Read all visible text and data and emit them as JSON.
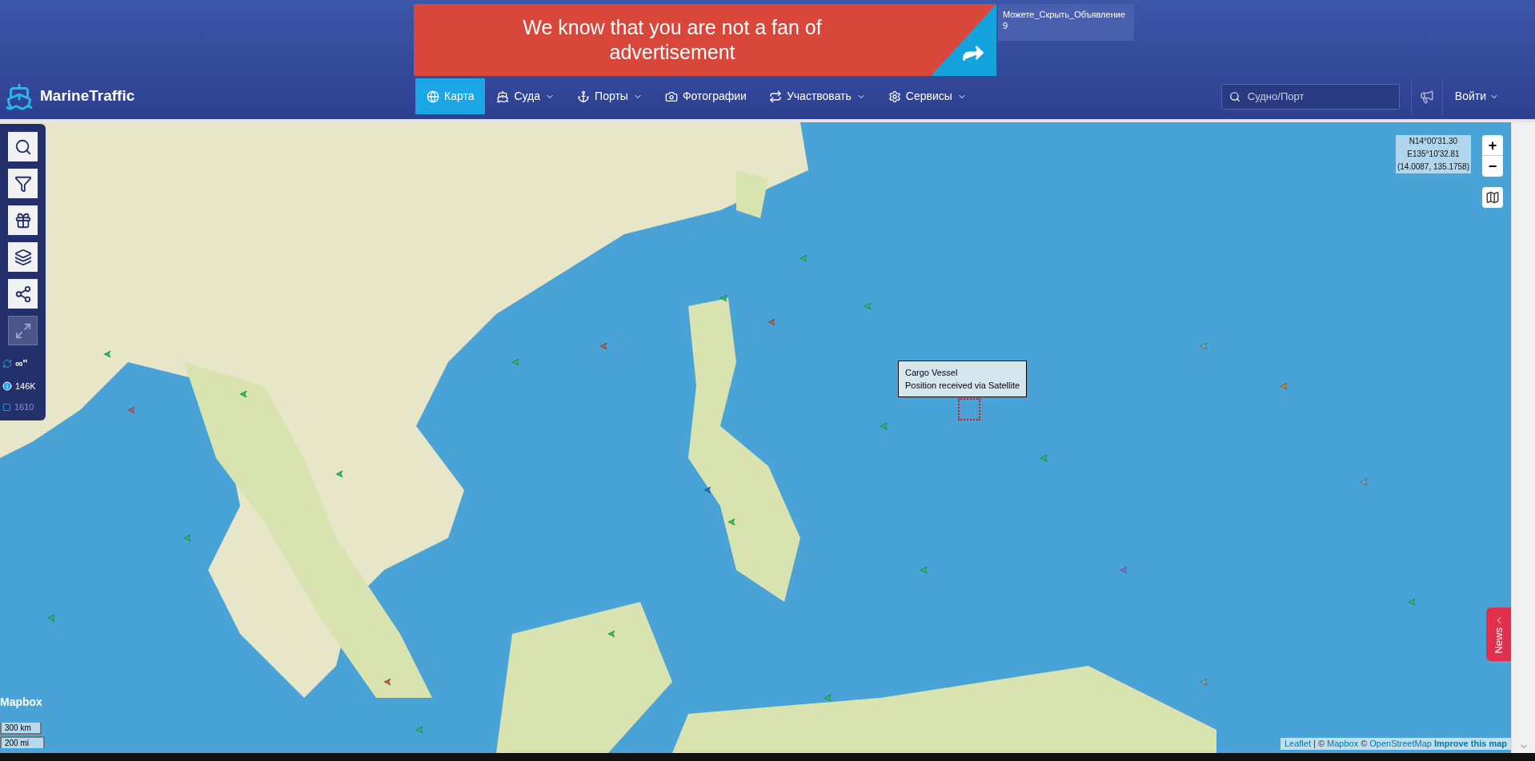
{
  "header": {
    "logo": {
      "text": "MarineTraffic"
    },
    "ad": {
      "text": "We know that you are not a fan of advertisement",
      "hide_label": "Можете_Скрыть_Объявление",
      "countdown": "9"
    },
    "nav": [
      {
        "label": "Карта",
        "dropdown": false,
        "selected": true
      },
      {
        "label": "Суда",
        "dropdown": true,
        "selected": false
      },
      {
        "label": "Порты",
        "dropdown": true,
        "selected": false
      },
      {
        "label": "Фотографии",
        "dropdown": false,
        "selected": false
      },
      {
        "label": "Участвовать",
        "dropdown": true,
        "selected": false
      },
      {
        "label": "Сервисы",
        "dropdown": true,
        "selected": false
      }
    ],
    "search": {
      "placeholder": "Судно/Порт"
    },
    "login": {
      "label": "Войти"
    }
  },
  "map": {
    "toolbar": {
      "buttons": [
        {
          "disabled": false
        },
        {
          "disabled": false
        },
        {
          "disabled": false
        },
        {
          "disabled": false
        },
        {
          "disabled": false
        },
        {
          "disabled": true
        }
      ],
      "stats": [
        {
          "kind": "refresh",
          "text": "∞\""
        },
        {
          "kind": "info",
          "text": "146K"
        },
        {
          "kind": "checkbox",
          "text": "1610",
          "checked": false
        }
      ]
    },
    "coordinates": [
      "N14°00'31.30",
      "E135°10'32.81",
      "(14.0087, 135.1758)"
    ],
    "zoom": [
      "+",
      "−"
    ],
    "tooltip": [
      "Cargo Vessel",
      "Position received via Satellite"
    ],
    "logo_text": "Mapbox",
    "scale": [
      "300 km",
      "200 mi"
    ],
    "attribution": [
      {
        "kind": "link",
        "text": "Leaflet"
      },
      {
        "kind": "text",
        "text": "| ©"
      },
      {
        "kind": "link",
        "text": "Mapbox"
      },
      {
        "kind": "text",
        "text": "©"
      },
      {
        "kind": "link",
        "text": "OpenStreetMap"
      },
      {
        "kind": "strong",
        "text": "Improve this map"
      }
    ],
    "news": {
      "label": "News"
    }
  }
}
